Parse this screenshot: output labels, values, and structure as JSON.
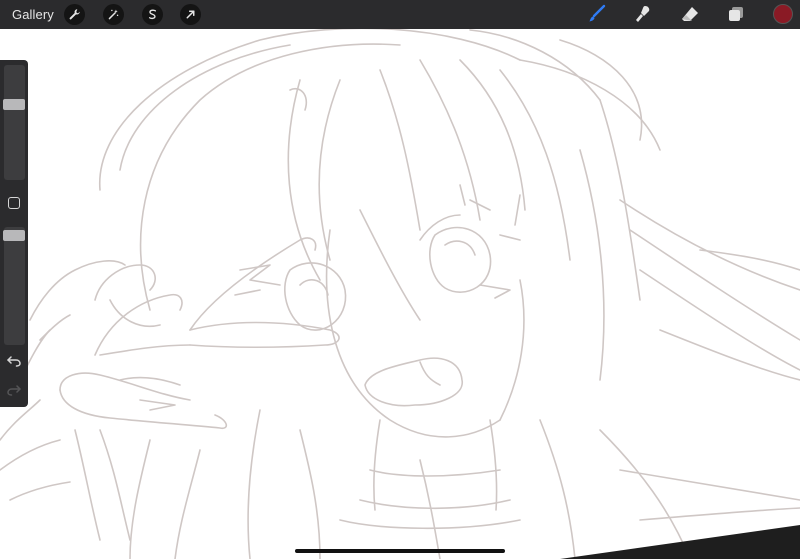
{
  "toolbar": {
    "gallery_label": "Gallery",
    "left_tools": [
      {
        "name": "actions",
        "icon": "wrench-icon"
      },
      {
        "name": "adjustments",
        "icon": "magic-wand-icon"
      },
      {
        "name": "selection",
        "icon": "selection-s-icon"
      },
      {
        "name": "transform",
        "icon": "arrow-cursor-icon"
      }
    ],
    "right_tools": [
      {
        "name": "brush",
        "icon": "brush-icon",
        "active": true,
        "color": "#2f7bf5"
      },
      {
        "name": "smudge",
        "icon": "smudge-icon",
        "active": false,
        "color": "#e6e6e6"
      },
      {
        "name": "eraser",
        "icon": "eraser-icon",
        "active": false,
        "color": "#e6e6e6"
      },
      {
        "name": "layers",
        "icon": "layers-icon",
        "active": false,
        "color": "#e6e6e6"
      }
    ],
    "current_color": "#8a1a25"
  },
  "sidebar": {
    "brush_size": 0.67,
    "brush_opacity": 0.97,
    "modify_icon": "square-icon",
    "undo_icon": "undo-icon",
    "redo_icon": "redo-icon",
    "redo_enabled": false
  },
  "canvas": {
    "sketch_color": "#cfc7c5",
    "background": "#ffffff"
  }
}
